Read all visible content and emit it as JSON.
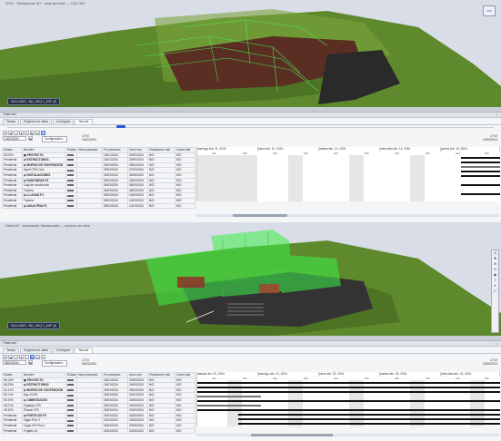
{
  "top": {
    "header_text": "2024 · Navisworks 4D · vista general — LOD 300",
    "viewport_label": "0314-SMS - NK_ARQ 1_MIF (3)",
    "view_cube": "TOP"
  },
  "timeliner_top": {
    "title": "TimeLiner",
    "tabs": [
      "Tareas",
      "Orígenes de datos",
      "Configurar",
      "Simular"
    ],
    "date": "13/02/2024",
    "config_button": "Configuración...",
    "time_top": "17:00",
    "time_bottom": "13/02/2024",
    "time_right_top": "17:00",
    "time_right_bottom": "20/09/2024",
    "columns": [
      "Estado",
      "Nombre",
      "Estado",
      "Inicio planeado",
      "Fin planeado",
      "Inicio real",
      "Finalización real",
      "Coste total"
    ],
    "rows": [
      [
        "53.00%",
        "▣ PROYECTO",
        "",
        "15/01/2024",
        "20/09/2024",
        "N/D",
        "N/D"
      ],
      [
        "Pendiente",
        "⊟ ESTRUCTURAS",
        "",
        "15/01/2024",
        "20/09/2024",
        "N/D",
        "N/D"
      ],
      [
        "Pendiente",
        "⊟ MUROS DE CONTENCIÓN",
        "",
        "25/03/2024",
        "25/04/2024",
        "N/D",
        "N/D"
      ],
      [
        "Pendiente",
        "Hgo0.CPA Cont",
        "",
        "25/03/2024",
        "27/03/2024",
        "N/D",
        "N/D"
      ],
      [
        "Pendiente",
        "⊟ INSTALACIONES",
        "",
        "05/03/2024",
        "30/06/2024",
        "N/D",
        "N/D"
      ],
      [
        "Pendiente",
        "⊟ SANITARIAS P1",
        "",
        "05/03/2024",
        "15/03/2024",
        "N/D",
        "N/D"
      ],
      [
        "Pendiente",
        "Caja de recolección",
        "",
        "05/03/2024",
        "06/03/2024",
        "N/D",
        "N/D"
      ],
      [
        "Pendiente",
        "Tubería",
        "",
        "06/03/2024",
        "08/03/2024",
        "N/D",
        "N/D"
      ],
      [
        "Pendiente",
        "⊟ LLUVIAS P1",
        "",
        "06/03/2024",
        "10/03/2024",
        "N/D",
        "N/D"
      ],
      [
        "Pendiente",
        "Tubería",
        "",
        "06/03/2024",
        "10/03/2024",
        "N/D",
        "N/D"
      ],
      [
        "Pendiente",
        "⊟ AGUA FRIA P1",
        "",
        "08/03/2024",
        "12/03/2024",
        "N/D",
        "N/D"
      ]
    ],
    "days": [
      "domingo feb. 11, 2024",
      "lunes feb. 12, 2024",
      "martes feb. 13, 2024",
      "miércoles feb. 14, 2024",
      "jueves feb. 15, 2024"
    ],
    "hours": [
      "AM",
      "PM"
    ]
  },
  "middle": {
    "header_text": "Vista 4D · simulación Navisworks — avance de obra",
    "viewport_label": "0314-SMS - NK_ARQ 1_MIF (3)"
  },
  "timeliner_bottom": {
    "title": "TimeLiner",
    "tabs": [
      "Tareas",
      "Orígenes de datos",
      "Configurar",
      "Simular"
    ],
    "date": "05/04/2024",
    "config_button": "Configuración...",
    "time_top": "17:00",
    "time_bottom": "05/04/2024",
    "time_right_top": "17:00",
    "time_right_bottom": "20/09/2024",
    "columns": [
      "Estado",
      "Nombre",
      "Estado",
      "Inicio planeado",
      "Fin planeado",
      "Inicio real",
      "Finalización real",
      "Coste total"
    ],
    "rows": [
      [
        "56.13%",
        "▣ PROYECTO",
        "",
        "15/01/2024",
        "20/09/2024",
        "N/D",
        "N/D"
      ],
      [
        "55.23%",
        "⊟ ESTRUCTURAS",
        "",
        "15/01/2024",
        "20/09/2024",
        "N/D",
        "N/D"
      ],
      [
        "51.41%",
        "⊟ MUROS DE CONTENCIÓN",
        "",
        "25/03/2024",
        "25/04/2024",
        "N/D",
        "N/D"
      ],
      [
        "50.71%",
        "Hgo.CCPA",
        "",
        "25/03/2024",
        "20/04/2024",
        "N/D",
        "N/D"
      ],
      [
        "50.20%",
        "⊟ CIMENTACIÓN",
        "",
        "25/03/2024",
        "20/05/2024",
        "N/D",
        "N/D"
      ],
      [
        "46.21%",
        "Zapatas CPC",
        "",
        "25/03/2024",
        "20/05/2024",
        "N/D",
        "N/D"
      ],
      [
        "45.30%",
        "Placas CPC",
        "",
        "25/03/2024",
        "20/05/2024",
        "N/D",
        "N/D"
      ],
      [
        "Pendiente",
        "⊟ PORTICOS P2",
        "",
        "20/04/2024",
        "20/05/2024",
        "N/D",
        "N/D"
      ],
      [
        "Pendiente",
        "Vigas Pórt. 2",
        "",
        "20/04/2024",
        "20/05/2024",
        "N/D",
        "N/D"
      ],
      [
        "Pendiente",
        "Cajas GS Piso 2",
        "",
        "20/04/2024",
        "20/05/2024",
        "N/D",
        "N/D"
      ],
      [
        "Pendiente",
        "Forjado p2",
        "",
        "20/04/2024",
        "20/05/2024",
        "N/D",
        "N/D"
      ]
    ],
    "days": [
      "sábado abr. 20, 2024",
      "domingo abr. 21, 2024",
      "lunes abr. 22, 2024",
      "martes abr. 23, 2024",
      "miércoles abr. 24, 2024"
    ],
    "hours": [
      "AM",
      "PM"
    ]
  },
  "colors": {
    "terrain": "#5e8a2d",
    "sky": "#d9dde8",
    "accent": "#2a5bd7",
    "ghost_green": "#3df04a"
  }
}
